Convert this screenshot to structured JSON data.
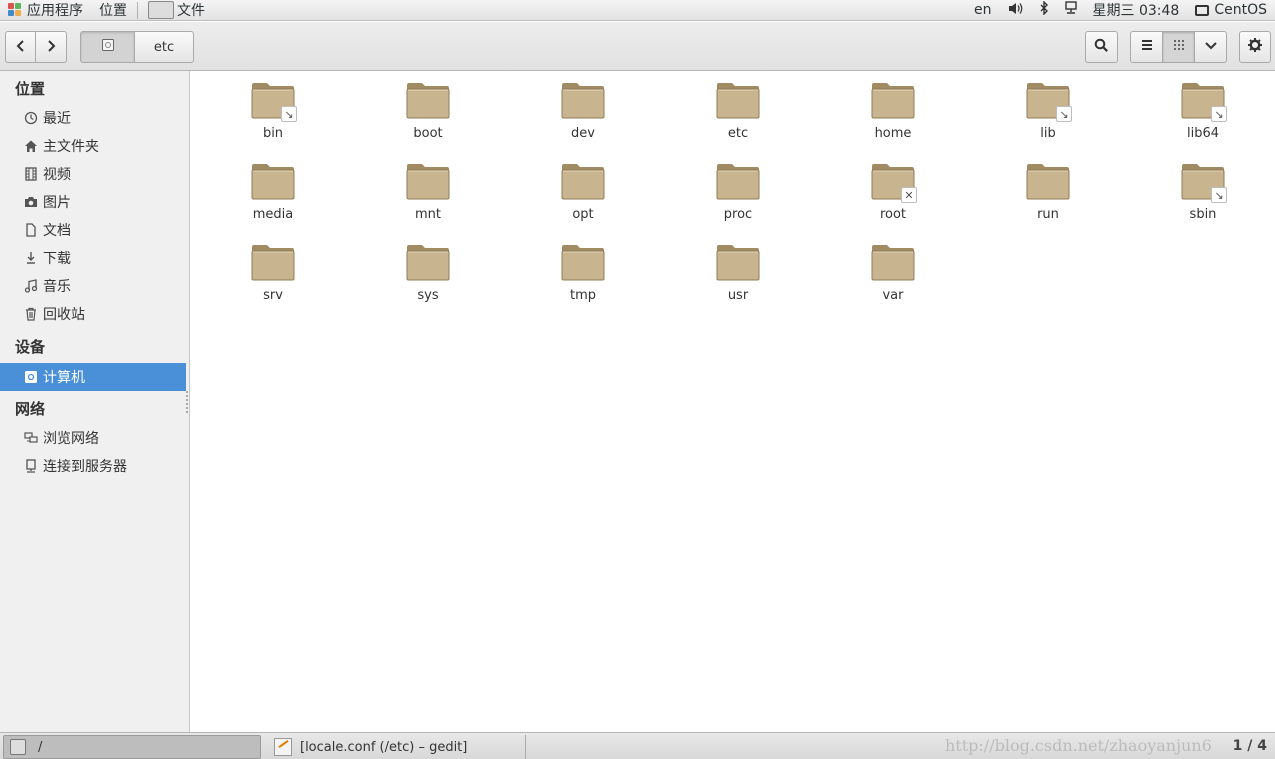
{
  "top_panel": {
    "apps_label": "应用程序",
    "places_label": "位置",
    "files_label": "文件",
    "lang": "en",
    "datetime": "星期三 03:48",
    "user": "CentOS"
  },
  "header": {
    "path_root_icon": "computer-icon",
    "path_current": "etc"
  },
  "sidebar": {
    "places_heading": "位置",
    "places_items": [
      {
        "label": "最近",
        "icon": "clock-icon"
      },
      {
        "label": "主文件夹",
        "icon": "home-icon"
      },
      {
        "label": "视频",
        "icon": "film-icon"
      },
      {
        "label": "图片",
        "icon": "camera-icon"
      },
      {
        "label": "文档",
        "icon": "document-icon"
      },
      {
        "label": "下载",
        "icon": "download-icon"
      },
      {
        "label": "音乐",
        "icon": "music-icon"
      },
      {
        "label": "回收站",
        "icon": "trash-icon"
      }
    ],
    "devices_heading": "设备",
    "devices_items": [
      {
        "label": "计算机",
        "icon": "computer-icon"
      }
    ],
    "network_heading": "网络",
    "network_items": [
      {
        "label": "浏览网络",
        "icon": "network-icon"
      },
      {
        "label": "连接到服务器",
        "icon": "server-icon"
      }
    ]
  },
  "files": [
    {
      "name": "bin",
      "emblem": "symlink"
    },
    {
      "name": "boot",
      "emblem": ""
    },
    {
      "name": "dev",
      "emblem": ""
    },
    {
      "name": "etc",
      "emblem": ""
    },
    {
      "name": "home",
      "emblem": ""
    },
    {
      "name": "lib",
      "emblem": "symlink"
    },
    {
      "name": "lib64",
      "emblem": "symlink"
    },
    {
      "name": "media",
      "emblem": ""
    },
    {
      "name": "mnt",
      "emblem": ""
    },
    {
      "name": "opt",
      "emblem": ""
    },
    {
      "name": "proc",
      "emblem": ""
    },
    {
      "name": "root",
      "emblem": "unreadable"
    },
    {
      "name": "run",
      "emblem": ""
    },
    {
      "name": "sbin",
      "emblem": "symlink"
    },
    {
      "name": "srv",
      "emblem": ""
    },
    {
      "name": "sys",
      "emblem": ""
    },
    {
      "name": "tmp",
      "emblem": ""
    },
    {
      "name": "usr",
      "emblem": ""
    },
    {
      "name": "var",
      "emblem": ""
    }
  ],
  "taskbar": {
    "active_task": "/",
    "gedit_task": "[locale.conf (/etc) – gedit]",
    "pager": "1 / 4",
    "watermark": "http://blog.csdn.net/zhaoyanjun6"
  },
  "colors": {
    "selection": "#4a90d9",
    "folder_body": "#c8b48e",
    "folder_tab": "#a08b63"
  }
}
